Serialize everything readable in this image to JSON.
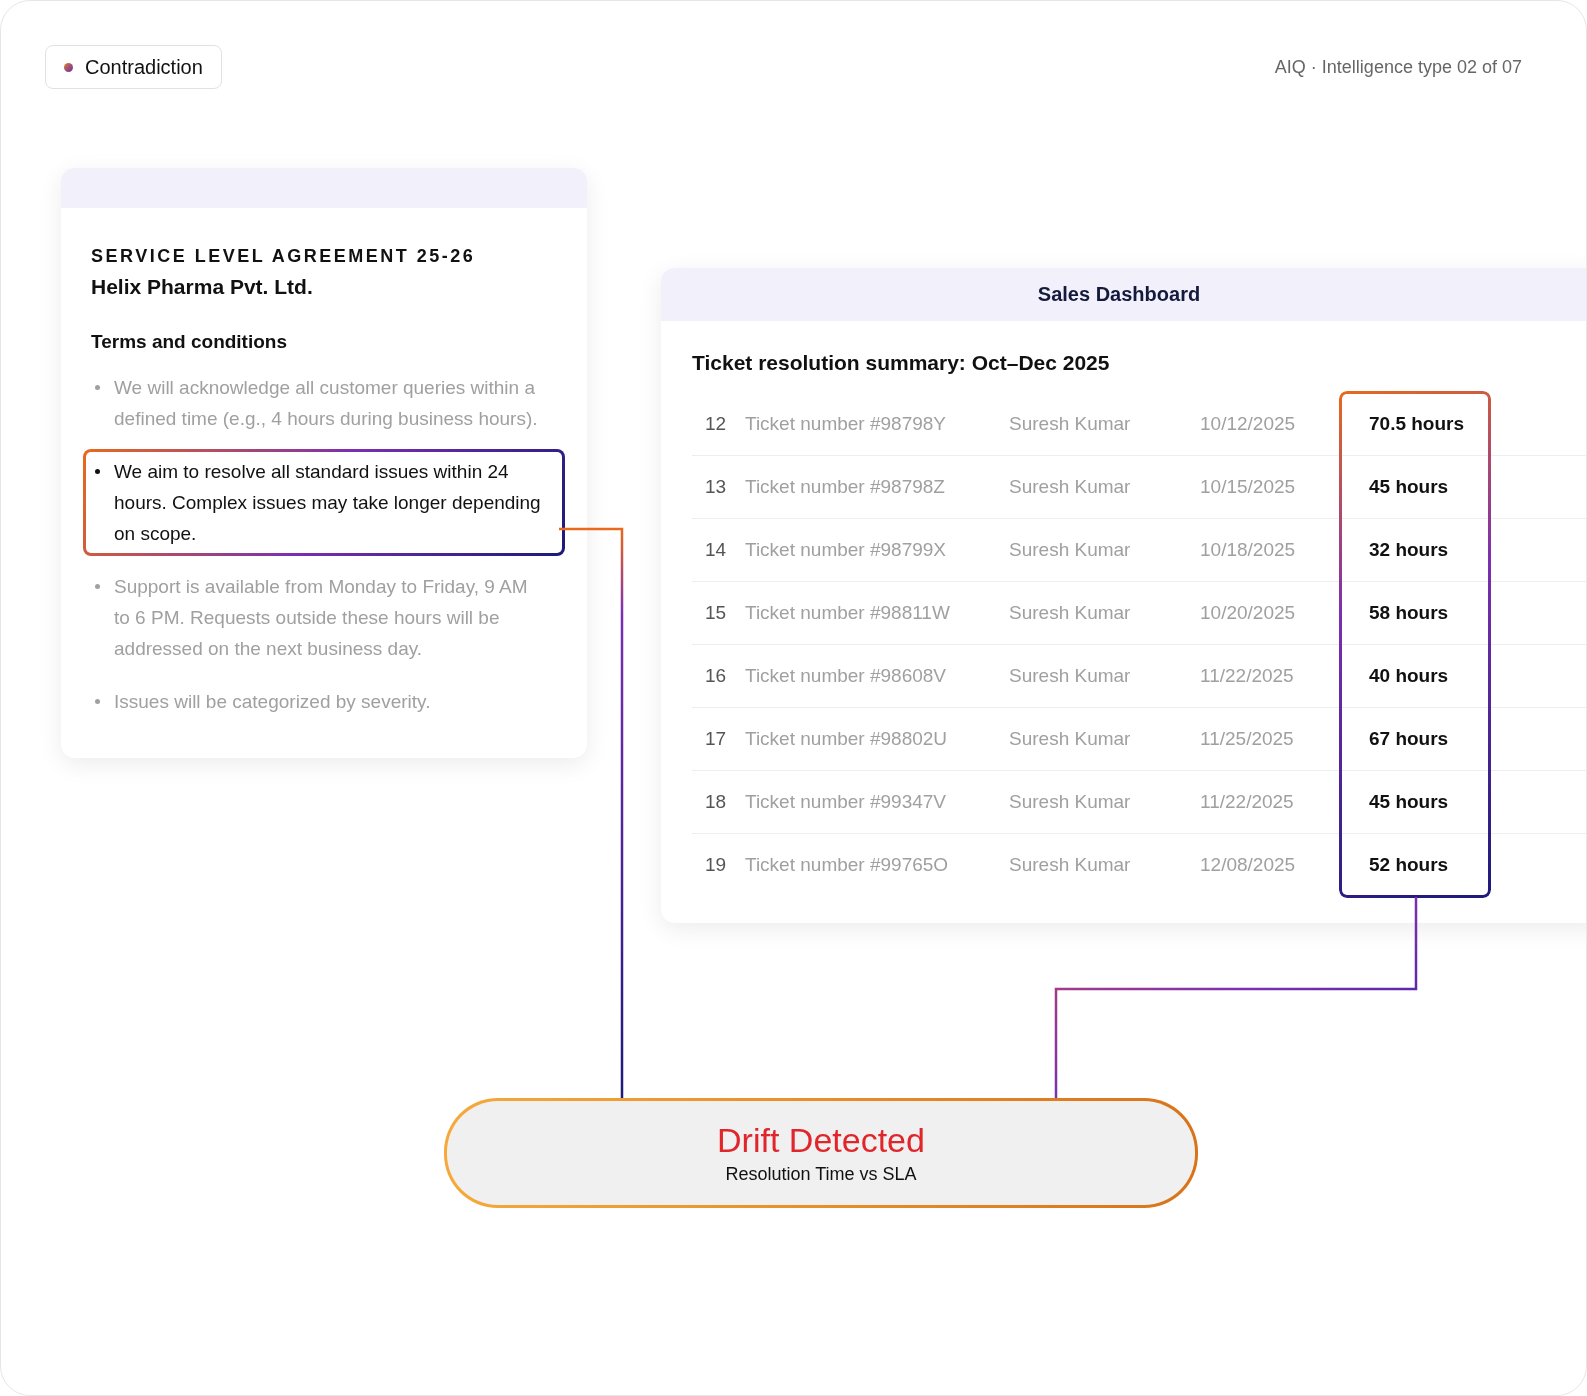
{
  "tag": {
    "label": "Contradiction"
  },
  "caption": "AIQ · Intelligence type 02 of 07",
  "agreement": {
    "eyebrow": "SERVICE LEVEL AGREEMENT 25-26",
    "company": "Helix Pharma Pvt. Ltd.",
    "section": "Terms and conditions",
    "items": [
      {
        "text": "We will acknowledge all customer queries within a defined time (e.g., 4 hours during business hours).",
        "highlighted": false
      },
      {
        "text": "We aim to resolve all standard issues within 24 hours. Complex issues may take longer depending on scope.",
        "highlighted": true
      },
      {
        "text": "Support is available from Monday to Friday, 9 AM to 6 PM. Requests outside these hours will be addressed on the next business day.",
        "highlighted": false
      },
      {
        "text": "Issues will be categorized by severity.",
        "highlighted": false
      }
    ]
  },
  "dashboard": {
    "title": "Sales Dashboard",
    "subtitle": "Ticket resolution summary: Oct–Dec 2025",
    "hours_highlighted": true,
    "rows": [
      {
        "number": "12",
        "ticket": "Ticket number #98798Y",
        "assignee": "Suresh Kumar",
        "date": "10/12/2025",
        "hours": "70.5 hours"
      },
      {
        "number": "13",
        "ticket": "Ticket number #98798Z",
        "assignee": "Suresh Kumar",
        "date": "10/15/2025",
        "hours": "45 hours"
      },
      {
        "number": "14",
        "ticket": "Ticket number #98799X",
        "assignee": "Suresh Kumar",
        "date": "10/18/2025",
        "hours": "32 hours"
      },
      {
        "number": "15",
        "ticket": "Ticket number #98811W",
        "assignee": "Suresh Kumar",
        "date": "10/20/2025",
        "hours": "58 hours"
      },
      {
        "number": "16",
        "ticket": "Ticket number #98608V",
        "assignee": "Suresh Kumar",
        "date": "11/22/2025",
        "hours": "40 hours"
      },
      {
        "number": "17",
        "ticket": "Ticket number #98802U",
        "assignee": "Suresh Kumar",
        "date": "11/25/2025",
        "hours": "67 hours"
      },
      {
        "number": "18",
        "ticket": "Ticket number #99347V",
        "assignee": "Suresh Kumar",
        "date": "11/22/2025",
        "hours": "45 hours"
      },
      {
        "number": "19",
        "ticket": "Ticket number #99765O",
        "assignee": "Suresh Kumar",
        "date": "12/08/2025",
        "hours": "52 hours"
      }
    ]
  },
  "alert": {
    "title": "Drift Detected",
    "subtitle": "Resolution Time vs SLA"
  }
}
